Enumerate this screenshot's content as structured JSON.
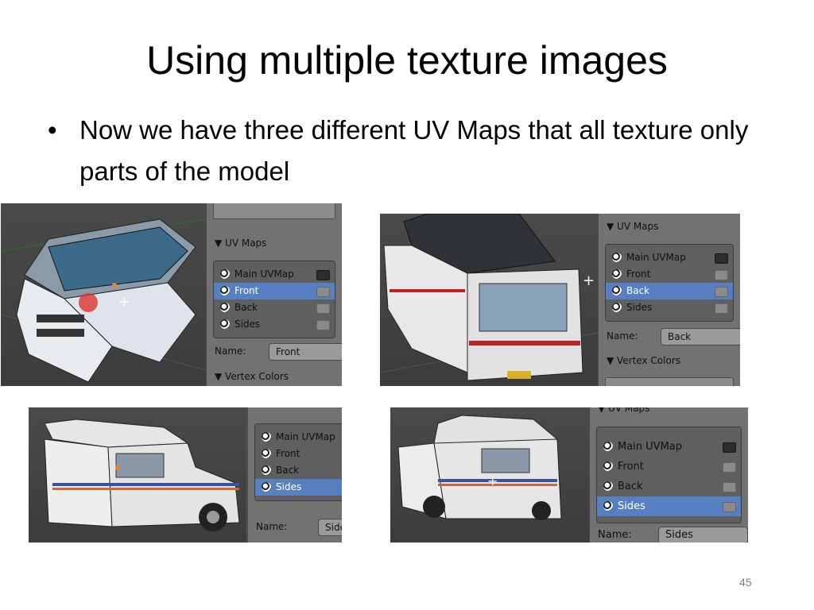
{
  "slide": {
    "title": "Using multiple texture images",
    "bullet_symbol": "•",
    "bullet_text": "Now we have three different UV Maps that all texture only parts of the model",
    "page_number": "45"
  },
  "panels": {
    "uv_maps_header": "▼ UV Maps",
    "vertex_colors_header": "▼ Vertex Colors",
    "name_label": "Name:",
    "uv_items": [
      "Main UVMap",
      "Front",
      "Back",
      "Sides"
    ]
  },
  "screenshots": [
    {
      "id": "front",
      "active": "Front",
      "name_value": "Front"
    },
    {
      "id": "back",
      "active": "Back",
      "name_value": "Back"
    },
    {
      "id": "sides-a",
      "active": "Sides",
      "name_value": "Side"
    },
    {
      "id": "sides-b",
      "active": "Sides",
      "name_value": "Sides"
    }
  ],
  "colors": {
    "active_row": "#5680c2",
    "panel_bg": "#727272",
    "viewport_bg": "#444444"
  }
}
